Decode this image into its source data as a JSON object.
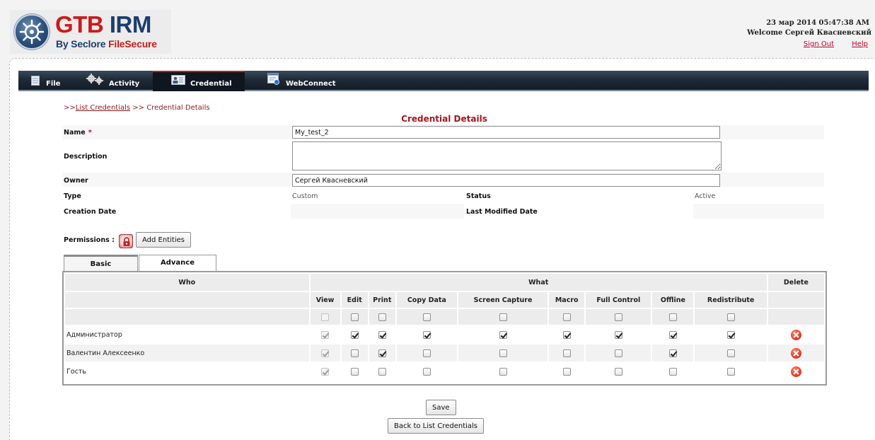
{
  "header": {
    "logo": {
      "title_main": "GTB",
      "title_accent": "IRM",
      "subtitle_by": "By Seclore",
      "subtitle_brand": "FileSecure"
    },
    "datetime": "23 мар 2014 05:47:38 AM",
    "welcome": "Welcome Сергей Квасневский",
    "sign_out": "Sign Out",
    "help": "Help"
  },
  "nav": {
    "tabs": [
      {
        "label": "File",
        "icon": "document-icon"
      },
      {
        "label": "Activity",
        "icon": "gears-icon"
      },
      {
        "label": "Credential",
        "icon": "id-card-icon",
        "active": true
      },
      {
        "label": "WebConnect",
        "icon": "web-window-icon"
      }
    ]
  },
  "breadcrumb": {
    "prefix": ">>",
    "link": "List Credentials",
    "separator": " >> ",
    "current": "Credential Details"
  },
  "page_title": "Credential Details",
  "form": {
    "name_label": "Name",
    "required_mark": "*",
    "name_value": "My_test_2",
    "description_label": "Description",
    "description_value": "",
    "owner_label": "Owner",
    "owner_value": "Сергей Квасневский",
    "type_label": "Type",
    "type_value": "Custom",
    "status_label": "Status",
    "status_value": "Active",
    "creation_label": "Creation Date",
    "creation_value": "",
    "modified_label": "Last Modified Date",
    "modified_value": ""
  },
  "permissions": {
    "label": "Permissions :",
    "add_entities": "Add Entities",
    "tabs": [
      "Basic",
      "Advance"
    ],
    "active_tab": 0,
    "headers": {
      "who": "Who",
      "what": "What",
      "delete": "Delete",
      "columns": [
        "View",
        "Edit",
        "Print",
        "Copy Data",
        "Screen Capture",
        "Macro",
        "Full Control",
        "Offline",
        "Redistribute"
      ]
    },
    "rows": [
      {
        "who": "Администратор",
        "perms": [
          true,
          true,
          true,
          true,
          true,
          true,
          true,
          true,
          true
        ]
      },
      {
        "who": "Валентин Алексеенко",
        "perms": [
          true,
          false,
          true,
          false,
          false,
          false,
          false,
          true,
          false
        ]
      },
      {
        "who": "Гость",
        "perms": [
          true,
          false,
          false,
          false,
          false,
          false,
          false,
          false,
          false
        ]
      }
    ]
  },
  "actions": {
    "save": "Save",
    "back": "Back to List Credentials"
  }
}
